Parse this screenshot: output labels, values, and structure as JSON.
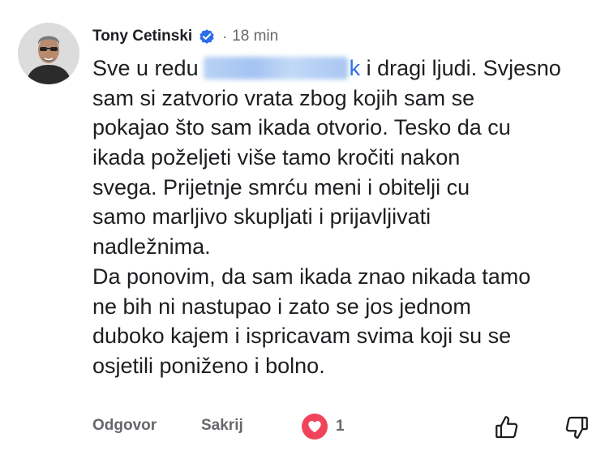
{
  "comment": {
    "author": "Tony Cetinski",
    "verified_icon": "verified-badge-icon",
    "separator": "·",
    "time": "18 min",
    "lines": {
      "l1_pre": "Sve u redu",
      "l1_mention_tail": "k",
      "l1_post": " i dragi ljudi. Svjesno",
      "l2": "sam si zatvorio vrata zbog kojih sam se",
      "l3": "pokajao što sam ikada otvorio. Tesko da cu",
      "l4": "ikada poželjeti više tamo kročiti nakon",
      "l5": "svega. Prijetnje smrću meni i obitelji cu",
      "l6": "samo marljivo skupljati i prijavljivati",
      "l7": "nadležnima.",
      "l8": "Da ponovim, da sam ikada znao nikada tamo",
      "l9": "ne bih ni nastupao i zato se jos jednom",
      "l10": "duboko kajem i ispricavam svima koji su se",
      "l11": "osjetili poniženo i bolno."
    }
  },
  "actions": {
    "reply_label": "Odgovor",
    "hide_label": "Sakrij",
    "reaction_icon": "heart-icon",
    "reaction_count": "1",
    "like_icon": "thumbs-up-icon",
    "dislike_icon": "thumbs-down-icon"
  },
  "colors": {
    "verified": "#2a6ee8",
    "mention": "#2a6ee8",
    "heart": "#f1445b",
    "secondary_text": "#65676b"
  }
}
